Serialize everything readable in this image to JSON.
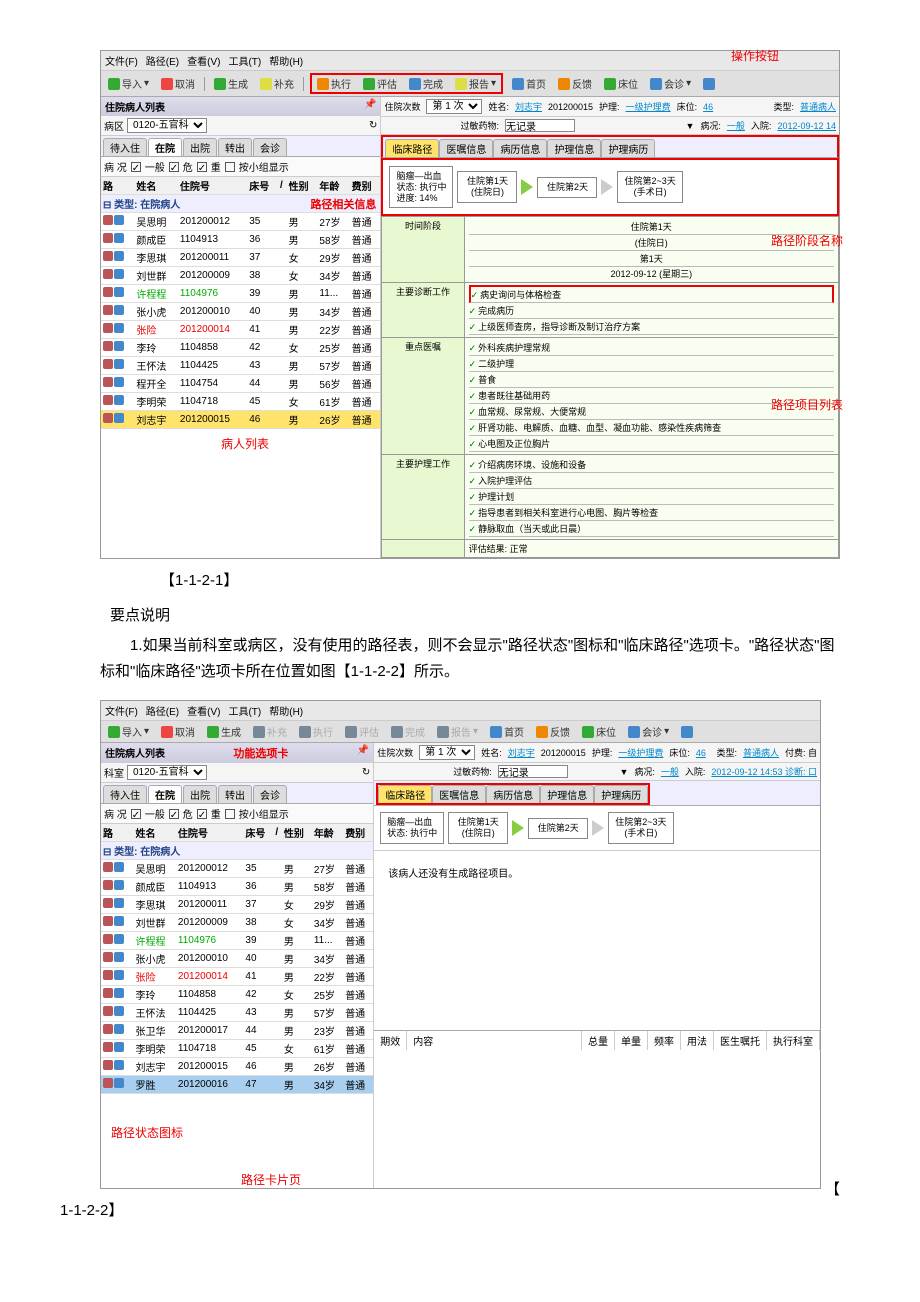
{
  "doc": {
    "caption1": "【1-1-2-1】",
    "heading1": "要点说明",
    "para1": "1.如果当前科室或病区，没有使用的路径表，则不会显示\"路径状态\"图标和\"临床路径\"选项卡。\"路径状态\"图标和\"临床路径\"选项卡所在位置如图【1-1-2-2】所示。",
    "caption2_prefix": "【",
    "caption2": "1-1-2-2】"
  },
  "menu": {
    "file": "文件(F)",
    "path": "路径(E)",
    "view": "查看(V)",
    "tool": "工具(T)",
    "help": "帮助(H)"
  },
  "toolbar": {
    "import": "导入",
    "cancel": "取消",
    "generate": "生成",
    "supplement": "补充",
    "execute": "执行",
    "evaluate": "评估",
    "complete": "完成",
    "report": "报告",
    "home": "首页",
    "feedback": "反馈",
    "bed": "床位",
    "consult": "会诊"
  },
  "annot": {
    "op_buttons": "操作按钮",
    "path_info": "路径相关信息",
    "patient_list": "病人列表",
    "phase_name": "路径阶段名称",
    "item_list": "路径项目列表",
    "func_tab": "功能选项卡",
    "status_icon": "路径状态图标",
    "card_page": "路径卡片页"
  },
  "left": {
    "title": "住院病人列表",
    "ward_lbl": "病区",
    "ward_opt": "0120-五官科",
    "tabs": {
      "pending": "待入住",
      "in": "在院",
      "out": "出院",
      "transfer": "转出",
      "consult": "会诊"
    },
    "filter": {
      "cond": "病 况",
      "must": "✓",
      "general": "一般",
      "imp": "✓",
      "danger": "危",
      "crit": "✓",
      "heavy": "重",
      "group": "按小组显示"
    },
    "cols": {
      "path": "路",
      "name": "姓名",
      "id": "住院号",
      "bed": "床号",
      "ud": "/",
      "sex": "性别",
      "age": "年龄",
      "fee": "费别"
    },
    "group": "类型: 在院病人",
    "rows": [
      {
        "name": "吴思明",
        "id": "201200012",
        "bed": "35",
        "sex": "男",
        "age": "27岁",
        "fee": "普通",
        "c": ""
      },
      {
        "name": "颜成臣",
        "id": "1104913",
        "bed": "36",
        "sex": "男",
        "age": "58岁",
        "fee": "普通",
        "c": ""
      },
      {
        "name": "李思琪",
        "id": "201200011",
        "bed": "37",
        "sex": "女",
        "age": "29岁",
        "fee": "普通",
        "c": ""
      },
      {
        "name": "刘世群",
        "id": "201200009",
        "bed": "38",
        "sex": "女",
        "age": "34岁",
        "fee": "普通",
        "c": ""
      },
      {
        "name": "许程程",
        "id": "1104976",
        "bed": "39",
        "sex": "男",
        "age": "11...",
        "fee": "普通",
        "c": "green"
      },
      {
        "name": "张小虎",
        "id": "201200010",
        "bed": "40",
        "sex": "男",
        "age": "34岁",
        "fee": "普通",
        "c": ""
      },
      {
        "name": "张险",
        "id": "201200014",
        "bed": "41",
        "sex": "男",
        "age": "22岁",
        "fee": "普通",
        "c": "red"
      },
      {
        "name": "李玲",
        "id": "1104858",
        "bed": "42",
        "sex": "女",
        "age": "25岁",
        "fee": "普通",
        "c": ""
      },
      {
        "name": "王怀法",
        "id": "1104425",
        "bed": "43",
        "sex": "男",
        "age": "57岁",
        "fee": "普通",
        "c": ""
      },
      {
        "name": "程开全",
        "id": "1104754",
        "bed": "44",
        "sex": "男",
        "age": "56岁",
        "fee": "普通",
        "c": ""
      },
      {
        "name": "李明荣",
        "id": "1104718",
        "bed": "45",
        "sex": "女",
        "age": "61岁",
        "fee": "普通",
        "c": ""
      },
      {
        "name": "刘志宇",
        "id": "201200015",
        "bed": "46",
        "sex": "男",
        "age": "26岁",
        "fee": "普通",
        "c": "sel"
      }
    ],
    "rows2_extra": [
      {
        "name": "张卫华",
        "id": "201200017",
        "bed": "44",
        "sex": "男",
        "age": "23岁",
        "fee": "普通",
        "c": ""
      },
      {
        "name": "李明荣",
        "id": "1104718",
        "bed": "45",
        "sex": "女",
        "age": "61岁",
        "fee": "普通",
        "c": ""
      },
      {
        "name": "刘志宇",
        "id": "201200015",
        "bed": "46",
        "sex": "男",
        "age": "26岁",
        "fee": "普通",
        "c": ""
      },
      {
        "name": "罗胜",
        "id": "201200016",
        "bed": "47",
        "sex": "男",
        "age": "34岁",
        "fee": "普通",
        "c": "sel2"
      }
    ],
    "ward_lbl2": "科室"
  },
  "right": {
    "info": {
      "visits_lbl": "住院次数",
      "visits_val": "第 1 次",
      "name_lbl": "姓名:",
      "name_val": "刘志宇",
      "pid": "201200015",
      "care_lbl": "护理:",
      "care_val": "一级护理费",
      "bed_lbl": "床位:",
      "bed_val": "46",
      "type_lbl": "类型:",
      "type_val": "普通病人",
      "allergy_lbl": "过敏药物:",
      "allergy_val": "无记录",
      "cond_lbl": "病况:",
      "cond_val": "一般",
      "admit_lbl": "入院:",
      "admit_val": "2012-09-12 14",
      "admit_val2": "2012-09-12 14:53 诊断: 口",
      "fee_lbl": "付费: 自"
    },
    "tabs": {
      "cp": "临床路径",
      "order": "医嘱信息",
      "record": "病历信息",
      "nurse": "护理信息",
      "nurserec": "护理病历"
    },
    "phase0": {
      "title": "脑瘤—出血",
      "state": "状态: 执行中",
      "progress": "进度: 14%"
    },
    "phases": [
      {
        "t1": "住院第1天",
        "t2": "(住院日)"
      },
      {
        "t1": "住院第2天",
        "t2": ""
      },
      {
        "t1": "住院第2~3天",
        "t2": "(手术日)"
      }
    ],
    "cp": {
      "time_hdr": "时间阶段",
      "time_rows": [
        "住院第1天",
        "(住院日)",
        "第1天",
        "2012-09-12 (星期三)"
      ],
      "diag_hdr": "主要诊断工作",
      "diag_rows": [
        "病史询问与体格检查",
        "完成病历",
        "上级医师查房，指导诊断及制订治疗方案"
      ],
      "doc_hdr": "重点医嘱",
      "doc_rows": [
        "外科疾病护理常规",
        "二级护理",
        "普食",
        "患者既往基础用药",
        "血常规、尿常规、大便常规",
        "肝肾功能、电解质、血糖、血型、凝血功能、感染性疾病筛查",
        "心电图及正位胸片"
      ],
      "nurse_hdr": "主要护理工作",
      "nurse_rows": [
        "介绍病房环境、设施和设备",
        "入院护理评估",
        "护理计划",
        "指导患者到相关科室进行心电图、胸片等检查",
        "静脉取血（当天或此日晨）"
      ],
      "eval": "评估结果: 正常"
    },
    "empty_msg": "该病人还没有生成路径项目。",
    "grid_cols": [
      "期效",
      "内容",
      "总量",
      "单量",
      "频率",
      "用法",
      "医生嘱托",
      "执行科室"
    ]
  }
}
